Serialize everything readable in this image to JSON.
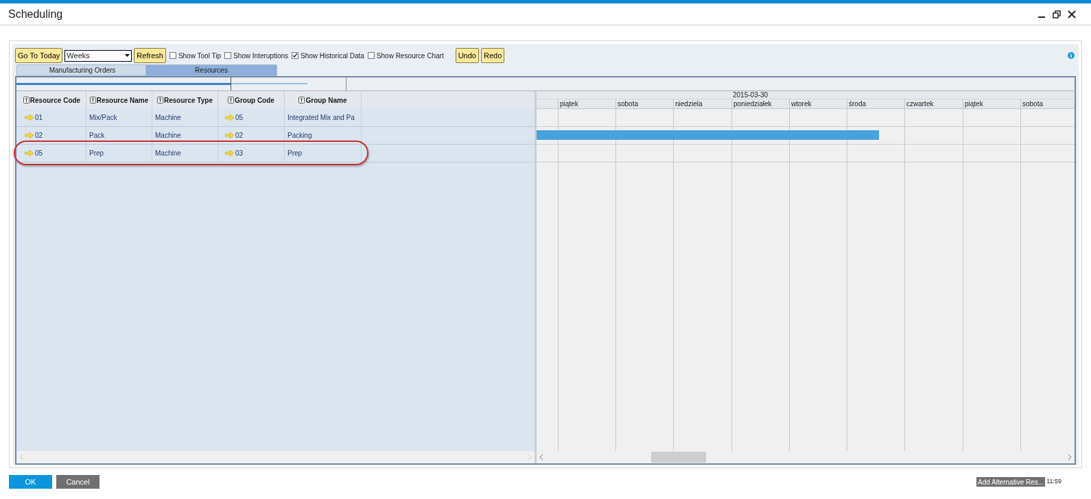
{
  "window": {
    "title": "Scheduling"
  },
  "toolbar": {
    "go_today": "Go To Today",
    "view": "Weeks",
    "refresh": "Refresh",
    "options": [
      {
        "label": "Show Tool Tip",
        "checked": false
      },
      {
        "label": "Show Interuptions",
        "checked": false
      },
      {
        "label": "Show Historical Data",
        "checked": true
      },
      {
        "label": "Show Resource Chart",
        "checked": false
      }
    ],
    "undo": "Undo",
    "redo": "Redo"
  },
  "tabs": [
    {
      "label": "Manufacturing Orders",
      "selected": false
    },
    {
      "label": "Resources",
      "selected": true
    }
  ],
  "table": {
    "columns": [
      "Resource Code",
      "Resource Name",
      "Resource Type",
      "Group Code",
      "Group Name"
    ],
    "rows": [
      {
        "cells": [
          "01",
          "Mix/Pack",
          "Machine",
          "05",
          "Integrated Mix and Pa"
        ],
        "highlighted": false,
        "booked": false
      },
      {
        "cells": [
          "02",
          "Pack",
          "Machine",
          "02",
          "Packing"
        ],
        "highlighted": false,
        "booked": true
      },
      {
        "cells": [
          "05",
          "Prep",
          "Machine",
          "03",
          "Prep"
        ],
        "highlighted": true,
        "booked": false
      }
    ]
  },
  "chart": {
    "date": "2015-03-30",
    "days": [
      "piątek",
      "sobota",
      "niedziela",
      "poniedziałek",
      "wtorek",
      "środa",
      "czwartek",
      "piątek",
      "sobota"
    ]
  },
  "footer": {
    "ok": "OK",
    "cancel": "Cancel",
    "status_button": "Add Alternative Res...",
    "time": "11:59"
  }
}
